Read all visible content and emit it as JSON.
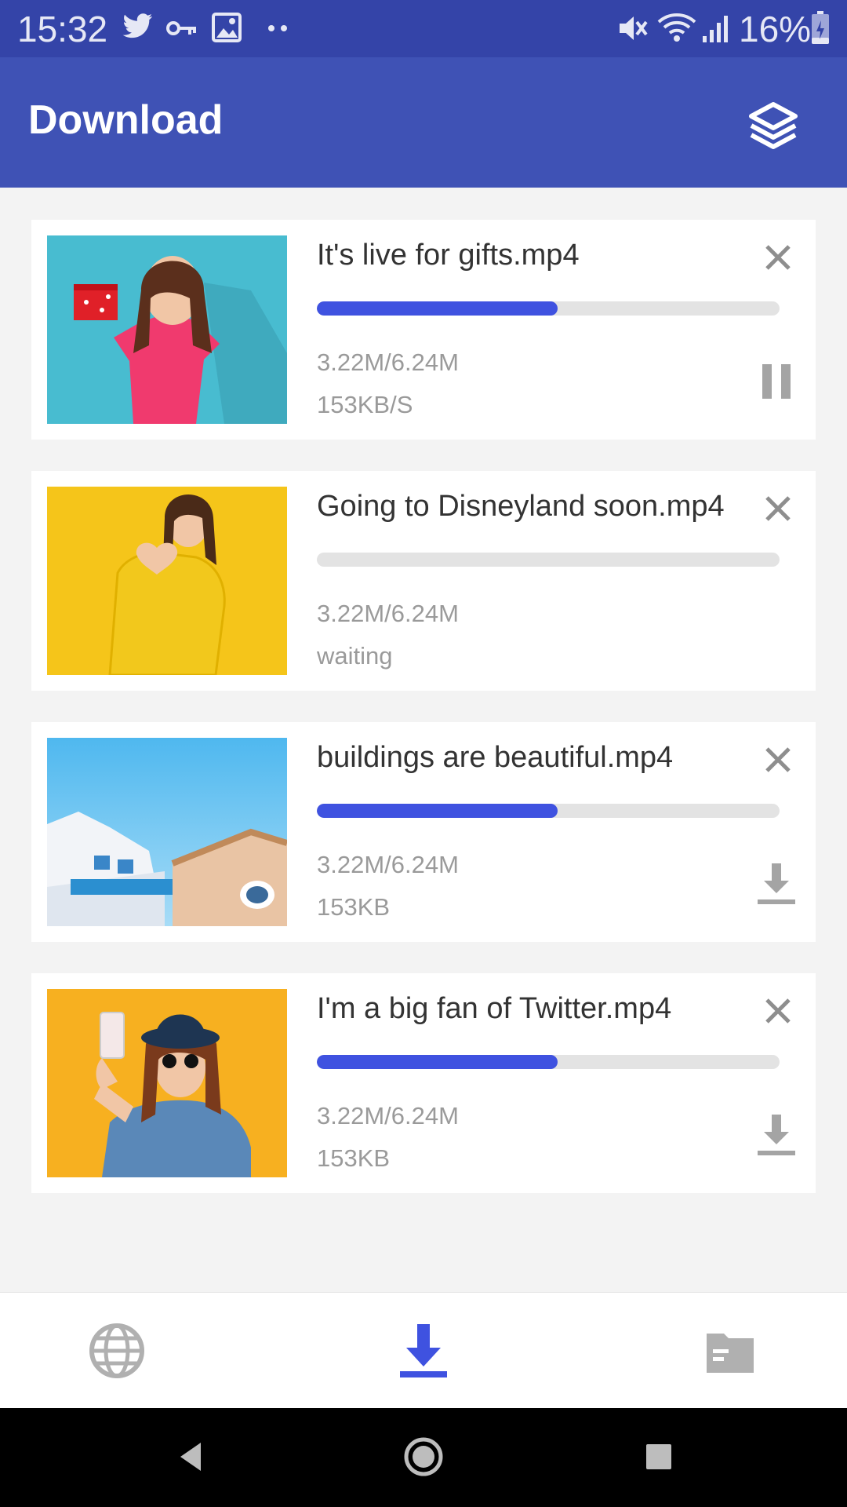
{
  "status_bar": {
    "time": "15:32",
    "battery": "16%",
    "icons": [
      "twitter-icon",
      "key-icon",
      "image-icon",
      "more-dots-icon",
      "mute-icon",
      "wifi-icon",
      "signal-icon",
      "battery-charging-icon"
    ]
  },
  "header": {
    "title": "Download",
    "action_icon": "layers-icon"
  },
  "downloads": [
    {
      "name": "It's live for gifts.mp4",
      "progress": 0.52,
      "size": "3.22M/6.24M",
      "status": "153KB/S",
      "action_icon": "pause-icon"
    },
    {
      "name": "Going to Disneyland soon.mp4",
      "progress": 0,
      "size": "3.22M/6.24M",
      "status": "waiting",
      "action_icon": ""
    },
    {
      "name": "buildings are beautiful.mp4",
      "progress": 0.52,
      "size": "3.22M/6.24M",
      "status": "153KB",
      "action_icon": "download-icon"
    },
    {
      "name": "I'm a big fan of Twitter.mp4",
      "progress": 0.52,
      "size": "3.22M/6.24M",
      "status": "153KB",
      "action_icon": "download-icon"
    }
  ],
  "bottom_nav": {
    "items": [
      "browser-globe-icon",
      "downloads-icon",
      "folder-icon"
    ],
    "active": "downloads-icon"
  },
  "colors": {
    "status_bar": "#3444a8",
    "app_bar": "#3f52b5",
    "accent": "#3f52e0",
    "background": "#f3f3f3"
  }
}
